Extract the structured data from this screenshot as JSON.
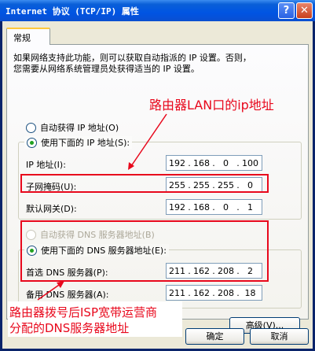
{
  "window": {
    "title": "Internet 协议 (TCP/IP) 属性",
    "help_label": "?",
    "close_label": "✕"
  },
  "tab": {
    "label": "常规"
  },
  "description": {
    "line1": "如果网络支持此功能，则可以获取自动指派的 IP 设置。否则，",
    "line2": "您需要从网络系统管理员处获得适当的 IP 设置。"
  },
  "ip_mode": {
    "auto_label": "自动获得 IP 地址(O)",
    "manual_label": "使用下面的 IP 地址(S):",
    "selected": "manual"
  },
  "ip_fields": {
    "ip_label": "IP 地址(I):",
    "ip_value": [
      "192",
      "168",
      "0",
      "100"
    ],
    "mask_label": "子网掩码(U):",
    "mask_value": [
      "255",
      "255",
      "255",
      "0"
    ],
    "gateway_label": "默认网关(D):",
    "gateway_value": [
      "192",
      "168",
      "0",
      "1"
    ]
  },
  "dns_mode": {
    "auto_label": "自动获得 DNS 服务器地址(B)",
    "manual_label": "使用下面的 DNS 服务器地址(E):",
    "selected": "manual"
  },
  "dns_fields": {
    "preferred_label": "首选 DNS 服务器(P):",
    "preferred_value": [
      "211",
      "162",
      "208",
      "2"
    ],
    "alternate_label": "备用 DNS 服务器(A):",
    "alternate_value": [
      "211",
      "162",
      "208",
      "18"
    ]
  },
  "buttons": {
    "advanced": "高级(V)...",
    "ok": "确定",
    "cancel": "取消"
  },
  "annotations": {
    "gateway_note": "路由器LAN口的ip地址",
    "dns_note_line1": "路由器拨号后ISP宽带运营商",
    "dns_note_line2": "分配的DNS服务器地址",
    "color": "#e8081c"
  }
}
